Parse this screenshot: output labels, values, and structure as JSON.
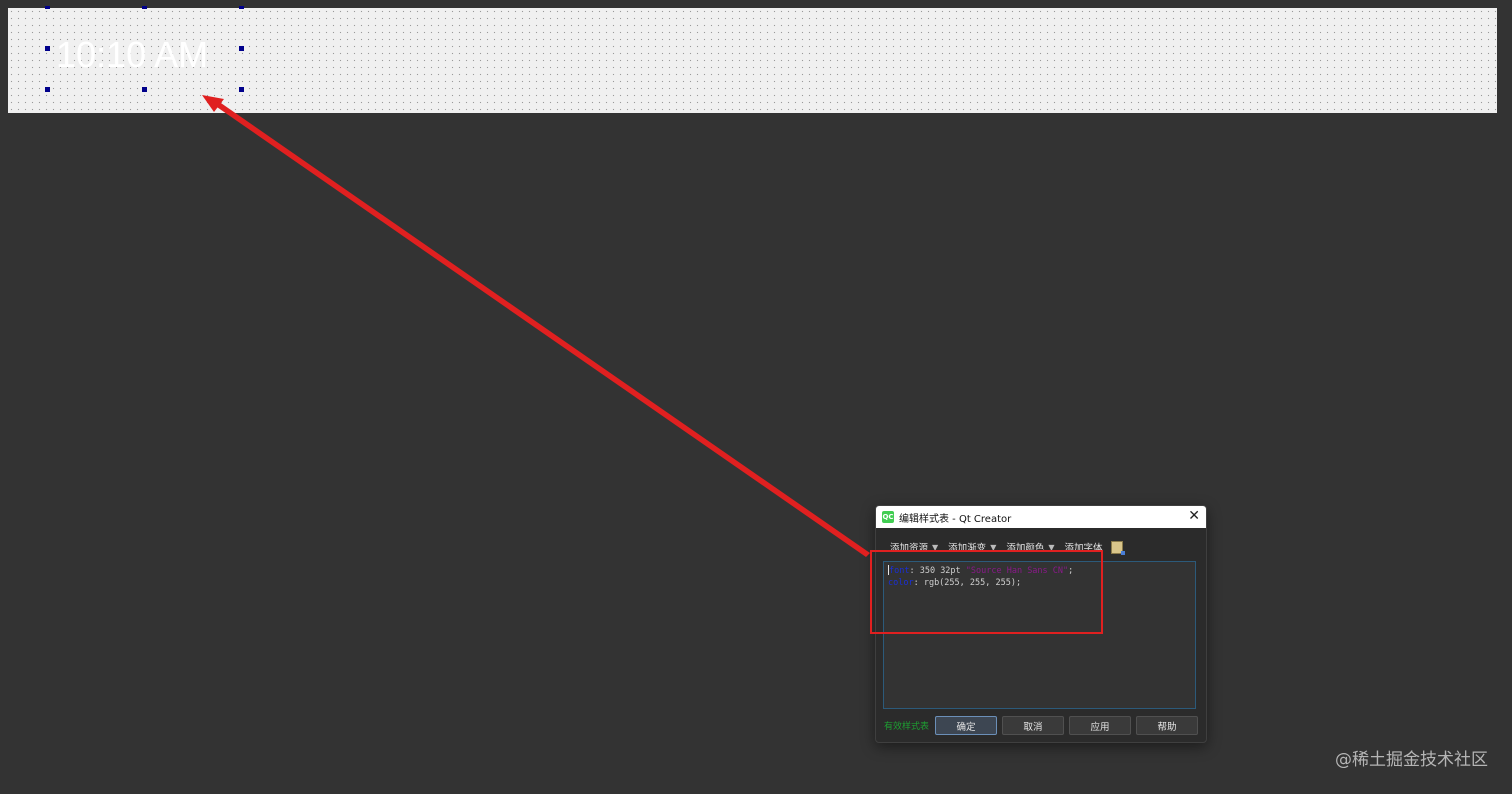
{
  "canvas": {
    "time_text": "10:10 AM"
  },
  "dialog": {
    "title": "编辑样式表 - Qt Creator",
    "logo_text": "QC",
    "close_icon": "close-icon",
    "toolbar": {
      "add_resource": "添加资源",
      "add_gradient": "添加渐变",
      "add_color": "添加颜色",
      "add_font": "添加字体",
      "icon": "color-picker-icon"
    },
    "editor": {
      "line1_prop": "font",
      "line1_value": ": 350 32pt ",
      "line1_str": "\"Source Han Sans CN\"",
      "line1_end": ";",
      "line2_prop": "color",
      "line2_value": ": rgb(255, 255, 255);"
    },
    "status_label": "有效样式表",
    "buttons": {
      "ok": "确定",
      "cancel": "取消",
      "apply": "应用",
      "help": "帮助"
    }
  },
  "watermark": "@稀土掘金技术社区",
  "colors": {
    "background": "#333333",
    "annotation_red": "#e02020",
    "valid_green": "#1e9e32",
    "keyword_blue": "#1a2fd6",
    "string_purple": "#8a1a8a"
  }
}
